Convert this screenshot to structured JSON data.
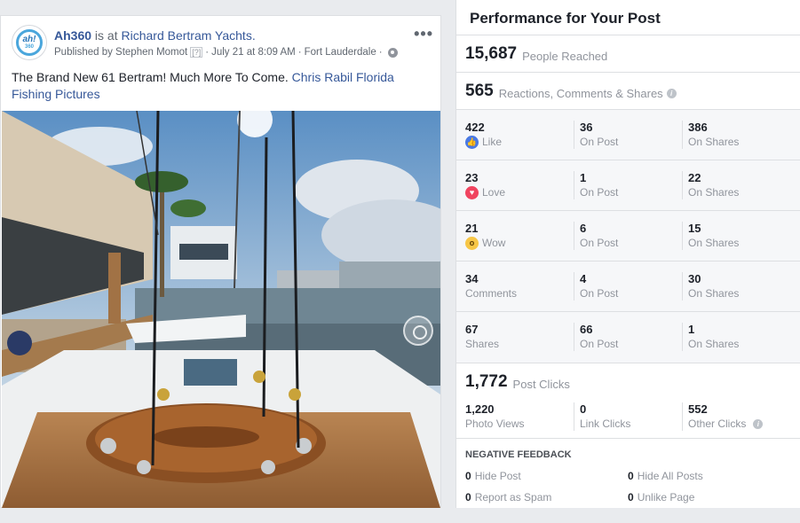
{
  "post": {
    "page_name": "Ah360",
    "verb": "is at",
    "location": "Richard Bertram Yachts.",
    "published_by": "Published by Stephen Momot",
    "q_badge": "[?]",
    "date": "July 21 at 8:09 AM",
    "place": "Fort Lauderdale",
    "more": "•••",
    "avatar_text": "ah!",
    "avatar_sub": "360",
    "text": "The Brand New 61 Bertram! Much More To Come.",
    "link_text": "Chris Rabil Florida Fishing Pictures"
  },
  "performance": {
    "title": "Performance for Your Post",
    "reached": {
      "value": "15,687",
      "label": "People Reached"
    },
    "engagement": {
      "value": "565",
      "label": "Reactions, Comments & Shares"
    },
    "rows": [
      {
        "total": "422",
        "label": "Like",
        "icon": "like-icon",
        "on_post": "36",
        "on_post_label": "On Post",
        "on_shares": "386",
        "on_shares_label": "On Shares"
      },
      {
        "total": "23",
        "label": "Love",
        "icon": "love-icon",
        "on_post": "1",
        "on_post_label": "On Post",
        "on_shares": "22",
        "on_shares_label": "On Shares"
      },
      {
        "total": "21",
        "label": "Wow",
        "icon": "wow-icon",
        "on_post": "6",
        "on_post_label": "On Post",
        "on_shares": "15",
        "on_shares_label": "On Shares"
      },
      {
        "total": "34",
        "label": "Comments",
        "on_post": "4",
        "on_post_label": "On Post",
        "on_shares": "30",
        "on_shares_label": "On Shares"
      },
      {
        "total": "67",
        "label": "Shares",
        "on_post": "66",
        "on_post_label": "On Post",
        "on_shares": "1",
        "on_shares_label": "On Shares"
      }
    ],
    "clicks": {
      "value": "1,772",
      "label": "Post Clicks",
      "photo_views": "1,220",
      "photo_views_label": "Photo Views",
      "link_clicks": "0",
      "link_clicks_label": "Link Clicks",
      "other_clicks": "552",
      "other_clicks_label": "Other Clicks"
    },
    "negative": {
      "title": "NEGATIVE FEEDBACK",
      "hide_post": "0",
      "hide_post_label": "Hide Post",
      "hide_all": "0",
      "hide_all_label": "Hide All Posts",
      "spam": "0",
      "spam_label": "Report as Spam",
      "unlike": "0",
      "unlike_label": "Unlike Page"
    }
  },
  "colors": {
    "link": "#365899",
    "muted": "#90949c",
    "like": "#4a79e3",
    "love": "#f0445f",
    "wow": "#f7c646"
  }
}
